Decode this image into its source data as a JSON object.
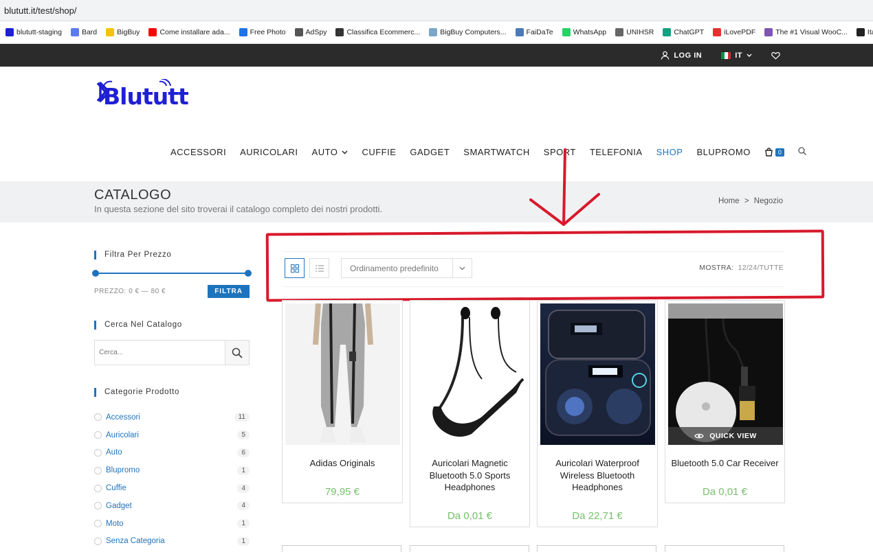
{
  "browser": {
    "url": "blututt.it/test/shop/",
    "bookmarks": [
      {
        "label": "blututt-staging",
        "icon": "bluetooth-icon",
        "color": "#1f1fd6"
      },
      {
        "label": "Bard",
        "icon": "sparkle-icon",
        "color": "#5b7bf0"
      },
      {
        "label": "BigBuy",
        "icon": "bigbuy-icon",
        "color": "#f5c400"
      },
      {
        "label": "Come installare ada...",
        "icon": "youtube-icon",
        "color": "#ff0000"
      },
      {
        "label": "Free Photo",
        "icon": "freepik-icon",
        "color": "#1e73e8"
      },
      {
        "label": "AdSpy",
        "icon": "adspy-icon",
        "color": "#555555"
      },
      {
        "label": "Classifica Ecommerc...",
        "icon": "spiral-icon",
        "color": "#333333"
      },
      {
        "label": "BigBuy Computers...",
        "icon": "globe-icon",
        "color": "#7aa7c7"
      },
      {
        "label": "FaiDaTe",
        "icon": "tools-icon",
        "color": "#4a7ab8"
      },
      {
        "label": "WhatsApp",
        "icon": "whatsapp-icon",
        "color": "#25d366"
      },
      {
        "label": "UNIHSR",
        "icon": "unihsr-icon",
        "color": "#666666"
      },
      {
        "label": "ChatGPT",
        "icon": "chatgpt-icon",
        "color": "#10a37f"
      },
      {
        "label": "iLovePDF",
        "icon": "heart-icon",
        "color": "#e5322d"
      },
      {
        "label": "The #1 Visual WooC...",
        "icon": "woo-icon",
        "color": "#7f54b3"
      },
      {
        "label": "Italian",
        "icon": "lm-icon",
        "color": "#222222"
      }
    ]
  },
  "topbar": {
    "login": "LOG IN",
    "lang": "IT"
  },
  "brand": {
    "logo_text": "Blututt"
  },
  "nav": {
    "items": [
      "ACCESSORI",
      "AURICOLARI",
      "AUTO",
      "CUFFIE",
      "GADGET",
      "SMARTWATCH",
      "SPORT",
      "TELEFONIA",
      "SHOP",
      "BLUPROMO"
    ],
    "active": "SHOP",
    "cart_count": "0"
  },
  "page": {
    "title": "CATALOGO",
    "subtitle": "In questa sezione del sito troverai il catalogo completo dei nostri prodotti.",
    "breadcrumb_home": "Home",
    "breadcrumb_sep": ">",
    "breadcrumb_current": "Negozio"
  },
  "sidebar": {
    "price_filter_title": "Filtra Per Prezzo",
    "price_label": "PREZZO: 0 € — 80 €",
    "filter_button": "FILTRA",
    "search_title": "Cerca Nel Catalogo",
    "search_placeholder": "Cerca...",
    "categories_title": "Categorie Prodotto",
    "categories": [
      {
        "name": "Accessori",
        "count": "11"
      },
      {
        "name": "Auricolari",
        "count": "5"
      },
      {
        "name": "Auto",
        "count": "6"
      },
      {
        "name": "Blupromo",
        "count": "1"
      },
      {
        "name": "Cuffie",
        "count": "4"
      },
      {
        "name": "Gadget",
        "count": "4"
      },
      {
        "name": "Moto",
        "count": "1"
      },
      {
        "name": "Senza Categoria",
        "count": "1"
      }
    ]
  },
  "toolbar": {
    "sort_value": "Ordinamento predefinito",
    "show_label": "MOSTRA:",
    "show_12": "12",
    "show_24": "24",
    "show_all": "TUTTE",
    "sep": "/"
  },
  "products": [
    {
      "name": "Adidas Originals",
      "price": "79,95 €"
    },
    {
      "name": "Auricolari Magnetic Bluetooth 5.0 Sports Headphones",
      "price": "Da 0,01 €"
    },
    {
      "name": "Auricolari Waterproof Wireless Bluetooth Headphones",
      "price": "Da 22,71 €"
    },
    {
      "name": "Bluetooth 5.0 Car Receiver",
      "price": "Da 0,01 €",
      "quick_view": "QUICK VIEW"
    }
  ],
  "annotation": {
    "color": "#d8192b"
  }
}
